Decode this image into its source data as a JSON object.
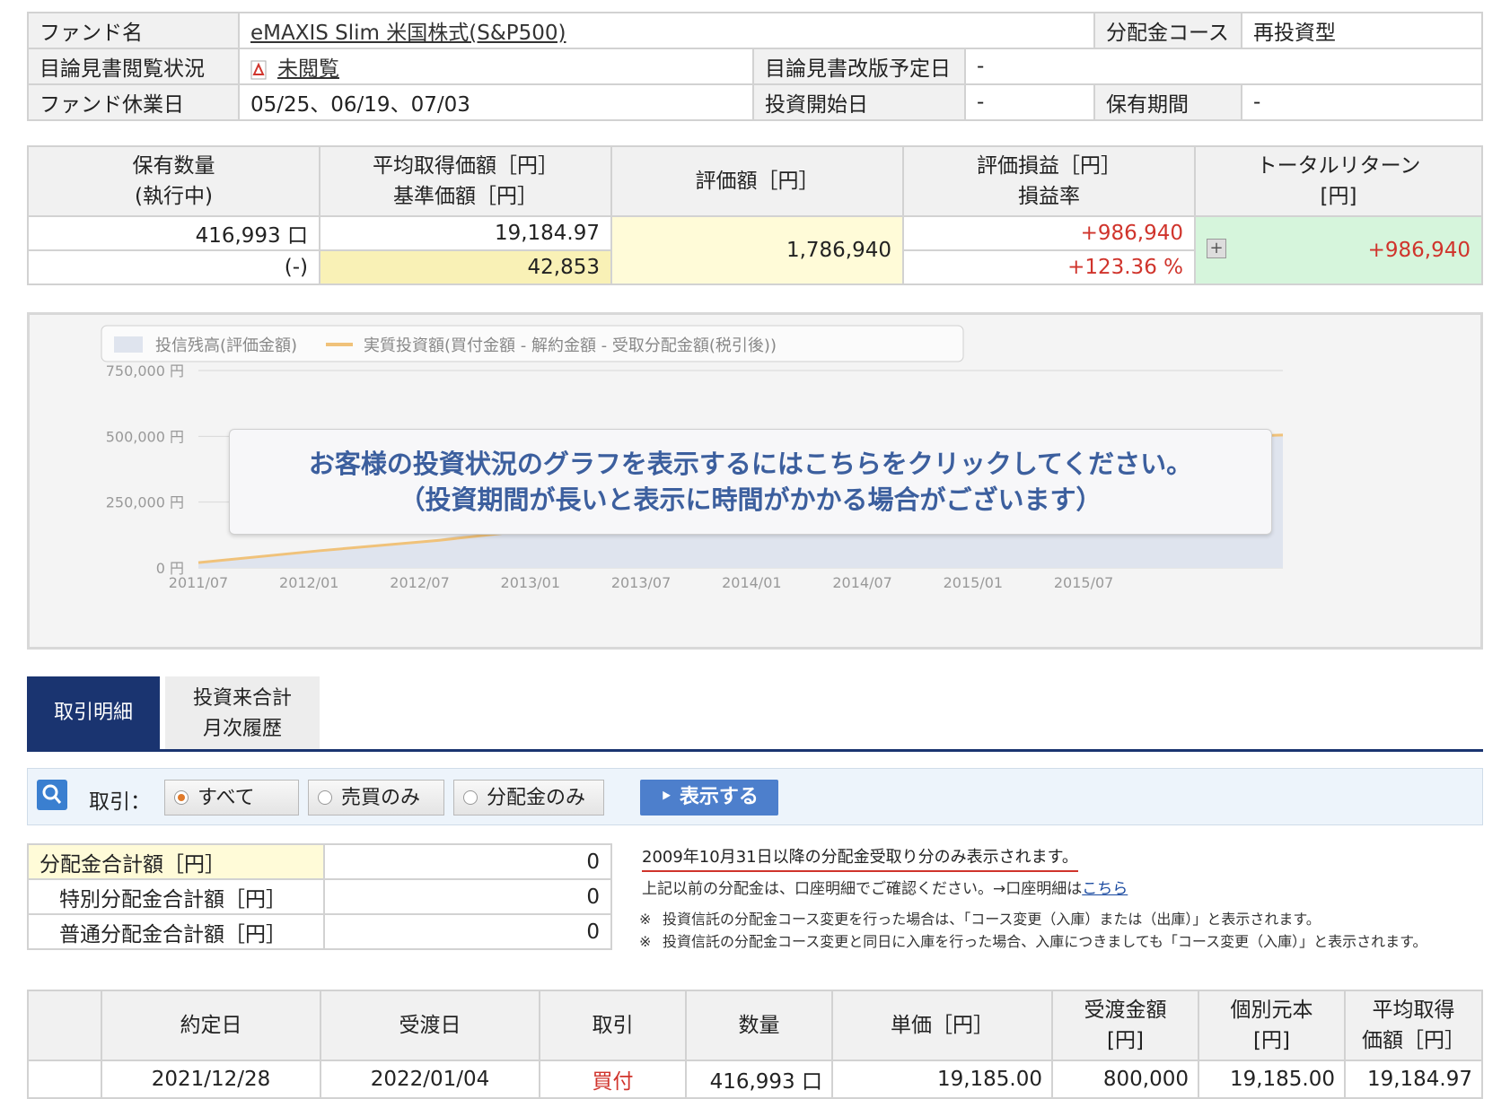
{
  "fund_info": {
    "fund_name_label": "ファンド名",
    "fund_name": "eMAXIS Slim 米国株式(S&P500)",
    "distribution_course_label": "分配金コース",
    "distribution_course": "再投資型",
    "prospectus_status_label": "目論見書閲覧状況",
    "prospectus_status": "未閲覧",
    "prospectus_revision_label": "目論見書改版予定日",
    "prospectus_revision": "-",
    "holiday_label": "ファンド休業日",
    "holidays": "05/25、06/19、07/03",
    "start_date_label": "投資開始日",
    "start_date": "-",
    "holding_period_label": "保有期間",
    "holding_period": "-"
  },
  "holdings": {
    "headers": {
      "quantity_1": "保有数量",
      "quantity_2": "(執行中)",
      "avg_price_1": "平均取得価額［円］",
      "avg_price_2": "基準価額［円］",
      "valuation": "評価額［円］",
      "pl_1": "評価損益［円］",
      "pl_2": "損益率",
      "total_return_1": "トータルリターン",
      "total_return_2": "[円]"
    },
    "quantity": "416,993 口",
    "quantity_pending": "(-)",
    "avg_price": "19,184.97",
    "base_price": "42,853",
    "valuation": "1,786,940",
    "pl": "+986,940",
    "pl_rate": "+123.36 %",
    "total_return": "+986,940"
  },
  "chart_overlay": {
    "line1": "お客様の投資状況のグラフを表示するにはこちらをクリックしてください。",
    "line2": "（投資期間が長いと表示に時間がかかる場合がございます）"
  },
  "chart_data": {
    "type": "area",
    "legend": [
      {
        "name": "投信残高(評価金額)",
        "color": "#dfe4ee"
      },
      {
        "name": "実質投資額(買付金額 - 解約金額 - 受取分配金額(税引後))",
        "color": "#f0c27a"
      }
    ],
    "legend_position": "top",
    "ylim": [
      0,
      750000
    ],
    "ytick_labels": [
      "750,000 円",
      "500,000 円",
      "250,000 円",
      "0 円"
    ],
    "ytick_values": [
      750000,
      500000,
      250000,
      0
    ],
    "xtick_labels": [
      "2011/07",
      "2012/01",
      "2012/07",
      "2013/01",
      "2013/07",
      "2014/01",
      "2014/07",
      "2015/01",
      "2015/07"
    ],
    "grid": true,
    "series": [
      {
        "name": "投信残高(評価金額)",
        "x": [
          "2011/07",
          "2012/01",
          "2012/07",
          "2013/01",
          "2013/07",
          "2014/01",
          "2014/07",
          "2015/01",
          "2015/07",
          "2015/12"
        ],
        "values": [
          20000,
          62000,
          110000,
          195000,
          285000,
          345000,
          420000,
          480000,
          520000,
          500000
        ]
      },
      {
        "name": "実質投資額(買付金額 - 解約金額 - 受取分配金額(税引後))",
        "x": [
          "2011/07",
          "2012/01",
          "2012/07",
          "2013/01",
          "2013/07",
          "2014/01",
          "2014/07",
          "2015/01",
          "2015/07",
          "2015/12"
        ],
        "values": [
          20000,
          65000,
          105000,
          155000,
          205000,
          260000,
          340000,
          420000,
          490000,
          505000
        ]
      }
    ]
  },
  "tabs": {
    "detail": "取引明細",
    "monthly_1": "投資来合計",
    "monthly_2": "月次履歴"
  },
  "filter": {
    "label": "取引：",
    "options": [
      "すべて",
      "売買のみ",
      "分配金のみ"
    ],
    "selected": "すべて",
    "button": "表示する"
  },
  "dividends": {
    "total_label": "分配金合計額［円］",
    "total": "0",
    "special_label": "特別分配金合計額［円］",
    "special": "0",
    "ordinary_label": "普通分配金合計額［円］",
    "ordinary": "0"
  },
  "notes": {
    "line1": "2009年10月31日以降の分配金受取り分のみ表示されます。",
    "line2_text": "上記以前の分配金は、口座明細でご確認ください。→口座明細は",
    "line2_link": "こちら",
    "bullet1": "投資信託の分配金コース変更を行った場合は、「コース変更（入庫）または（出庫）」と表示されます。",
    "bullet2": "投資信託の分配金コース変更と同日に入庫を行った場合、入庫につきましても「コース変更（入庫）」と表示されます。"
  },
  "transactions": {
    "headers": {
      "trade_date": "約定日",
      "settle_date": "受渡日",
      "type": "取引",
      "quantity": "数量",
      "unit_price": "単価［円］",
      "amount_1": "受渡金額",
      "amount_2": "[円]",
      "principal_1": "個別元本",
      "principal_2": "[円]",
      "avg_1": "平均取得",
      "avg_2": "価額［円］"
    },
    "rows": [
      {
        "trade_date": "2021/12/28",
        "settle_date": "2022/01/04",
        "type": "買付",
        "quantity": "416,993 口",
        "unit_price": "19,185.00",
        "amount": "800,000",
        "principal": "19,185.00",
        "avg_price": "19,184.97"
      }
    ]
  }
}
